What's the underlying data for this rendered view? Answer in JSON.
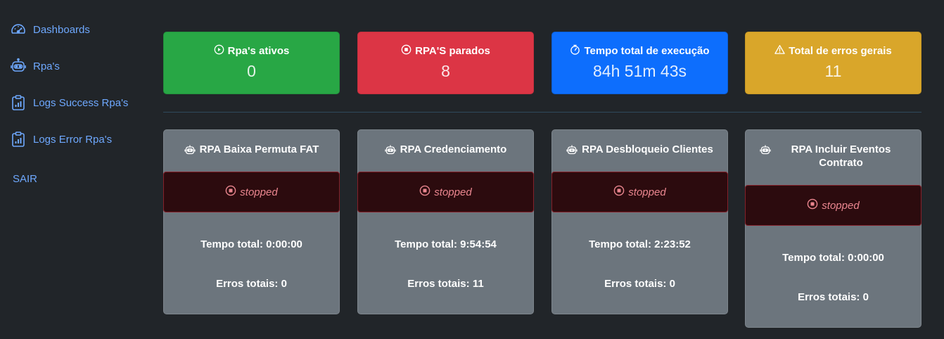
{
  "sidebar": {
    "items": [
      {
        "label": "Dashboards",
        "icon": "speedometer-icon"
      },
      {
        "label": "Rpa's",
        "icon": "robot-icon"
      },
      {
        "label": "Logs Success Rpa's",
        "icon": "clipboard-chart-icon"
      },
      {
        "label": "Logs Error Rpa's",
        "icon": "clipboard-chart-icon"
      }
    ],
    "logout_label": "SAIR"
  },
  "stats": [
    {
      "title": "Rpa's ativos",
      "value": "0",
      "icon": "play-circle-icon",
      "color": "#28a745"
    },
    {
      "title": "RPA'S parados",
      "value": "8",
      "icon": "stop-circle-icon",
      "color": "#dc3545"
    },
    {
      "title": "Tempo total de execução",
      "value": "84h 51m 43s",
      "icon": "stopwatch-icon",
      "color": "#0d6efd"
    },
    {
      "title": "Total de erros gerais",
      "value": "11",
      "icon": "warning-icon",
      "color": "#d9a62a"
    }
  ],
  "rpas": [
    {
      "name": "RPA Baixa Permuta FAT",
      "status": "stopped",
      "total_time": "Tempo total: 0:00:00",
      "total_errors": "Erros totais: 0"
    },
    {
      "name": "RPA Credenciamento",
      "status": "stopped",
      "total_time": "Tempo total: 9:54:54",
      "total_errors": "Erros totais: 11"
    },
    {
      "name": "RPA Desbloqueio Clientes",
      "status": "stopped",
      "total_time": "Tempo total: 2:23:52",
      "total_errors": "Erros totais: 0"
    },
    {
      "name": "RPA Incluir Eventos Contrato",
      "status": "stopped",
      "total_time": "Tempo total: 0:00:00",
      "total_errors": "Erros totais: 0"
    }
  ]
}
